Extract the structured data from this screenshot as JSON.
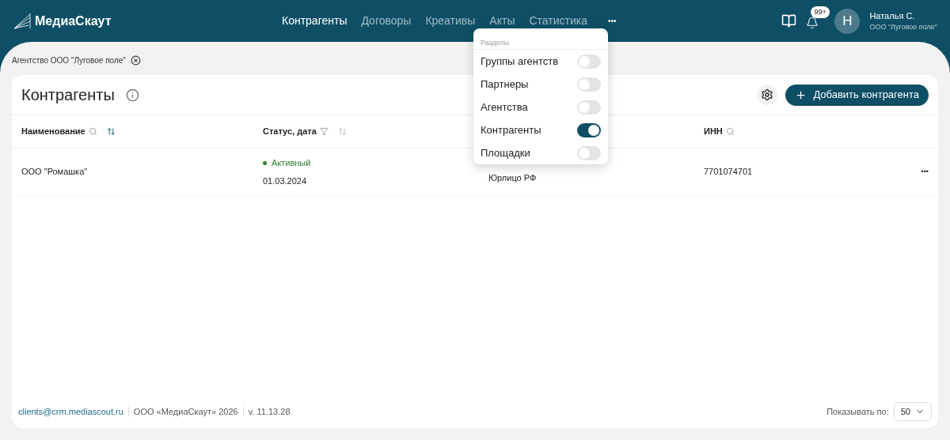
{
  "header": {
    "logo": "МедиаСкаут",
    "nav": [
      {
        "label": "Контрагенты",
        "selected": true
      },
      {
        "label": "Договоры",
        "selected": false
      },
      {
        "label": "Креативы",
        "selected": false
      },
      {
        "label": "Акты",
        "selected": false
      },
      {
        "label": "Статистика",
        "selected": false
      }
    ],
    "more": "•••",
    "badge": "99+",
    "avatar": "Н",
    "user_name": "Наталья С.",
    "user_org": "ООО \"Луговое поле\""
  },
  "dropdown": {
    "title": "Разделы",
    "items": [
      {
        "label": "Группы агентств",
        "on": false
      },
      {
        "label": "Партнеры",
        "on": false
      },
      {
        "label": "Агентства",
        "on": false
      },
      {
        "label": "Контрагенты",
        "on": true
      },
      {
        "label": "Площадки",
        "on": false
      }
    ]
  },
  "filter_chip": "Агентство ООО \"Луговое поле\"",
  "card": {
    "title": "Контрагенты",
    "add_button": "Добавить контрагента"
  },
  "table": {
    "columns": [
      {
        "label": "Наименование",
        "icons": [
          {
            "kind": "search"
          },
          {
            "kind": "sort",
            "active": true
          }
        ]
      },
      {
        "label": "Статус, дата",
        "icons": [
          {
            "kind": "filter"
          },
          {
            "kind": "sort",
            "active": false
          }
        ]
      },
      {
        "label": "ИНН",
        "icons": [
          {
            "kind": "search"
          }
        ]
      }
    ],
    "rows": [
      {
        "name": "ООО \"Ромашка\"",
        "status": {
          "text": "Активный",
          "color": "#2e7d32"
        },
        "date": "01.03.2024",
        "column_3": "Юрлицо РФ",
        "inn": "7701074701",
        "menu": "•••"
      }
    ]
  },
  "footer": {
    "email": "clients@crm.mediascout.ru",
    "company": "ООО «МедиаСкаут» 2026",
    "version": "v. 11.13.28",
    "page_size_label": "Показывать по:",
    "page_size": "50"
  }
}
